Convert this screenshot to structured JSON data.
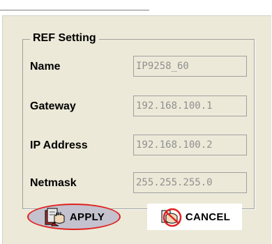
{
  "group": {
    "title": "REF Setting"
  },
  "fields": [
    {
      "label": "Name",
      "value": "IP9258_60"
    },
    {
      "label": "Gateway",
      "value": "192.168.100.1"
    },
    {
      "label": "IP Address",
      "value": "192.168.100.2"
    },
    {
      "label": "Netmask",
      "value": "255.255.255.0"
    }
  ],
  "buttons": {
    "apply_label": "APPLY",
    "cancel_label": "CANCEL"
  },
  "icons": {
    "apply": "hand-on-book-icon",
    "cancel": "prohibited-hand-icon"
  },
  "colors": {
    "dialog_bg": "#ece9d8",
    "field_text": "#909090",
    "apply_highlight": "#e02020"
  }
}
